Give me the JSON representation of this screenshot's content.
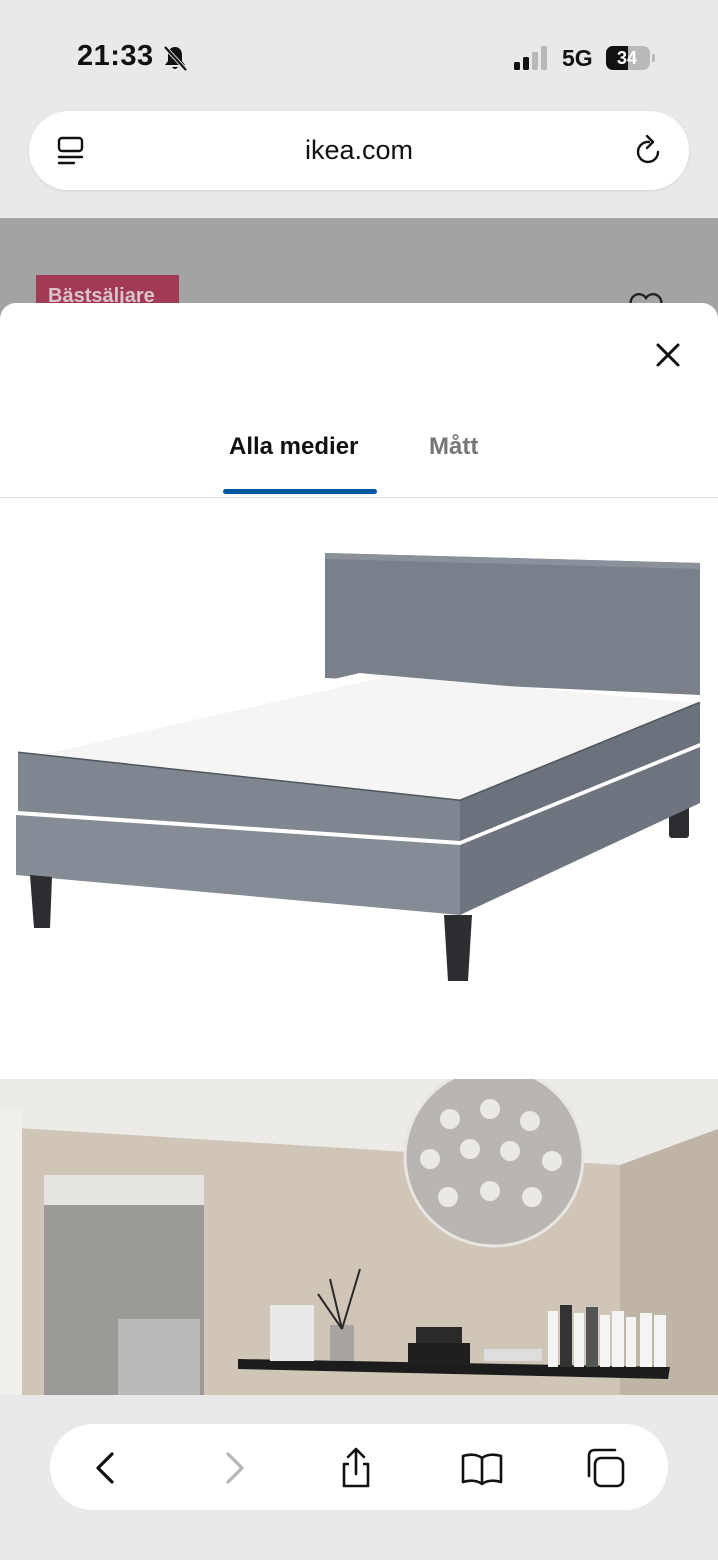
{
  "status_bar": {
    "time": "21:33",
    "network": "5G",
    "battery": "34",
    "icons": [
      "bell-slash-icon",
      "signal-icon",
      "battery-icon"
    ]
  },
  "browser": {
    "url": "ikea.com",
    "icons": [
      "reader-icon",
      "reload-icon"
    ]
  },
  "background_page": {
    "badge": "Bästsäljare",
    "icons": [
      "heart-icon"
    ]
  },
  "modal": {
    "tabs": [
      {
        "label": "Alla medier",
        "active": true
      },
      {
        "label": "Mått",
        "active": false
      }
    ],
    "accent_color": "#0058a3",
    "media": [
      "bed-product-image",
      "bedroom-room-image"
    ]
  },
  "toolbar": {
    "icons": [
      "back-icon",
      "forward-icon",
      "share-icon",
      "bookmarks-icon",
      "tabs-icon"
    ]
  }
}
